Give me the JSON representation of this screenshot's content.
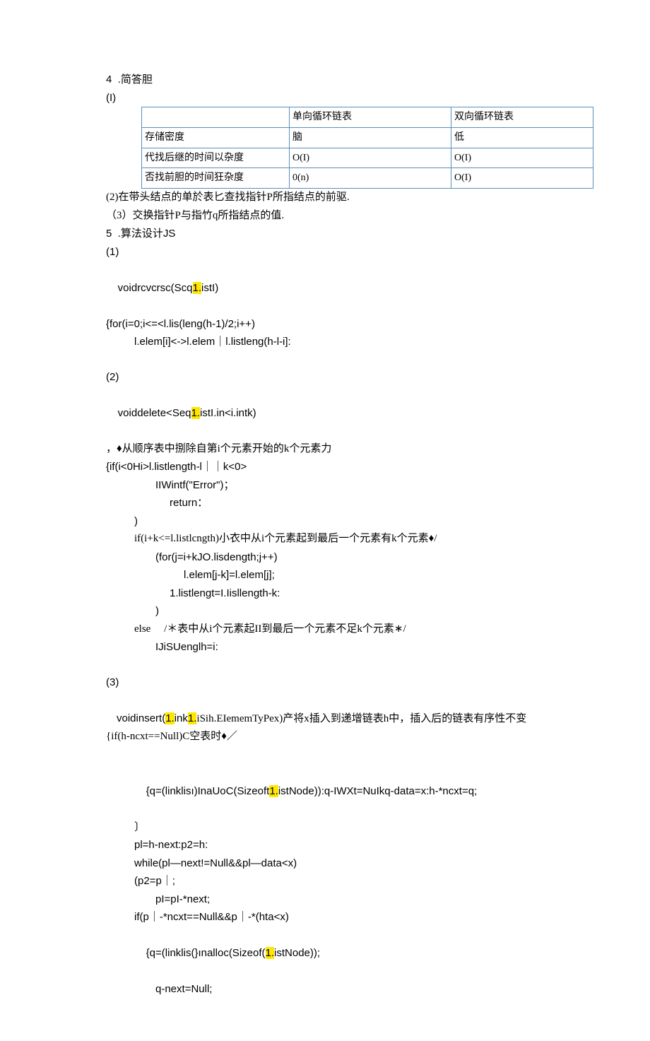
{
  "h4": "4  .简答胆",
  "l_I": "(I)",
  "table": {
    "r0": {
      "c0": "",
      "c1": "单向循环链表",
      "c2": "双向循环链表"
    },
    "r1": {
      "c0": "存储密度",
      "c1": "脑",
      "c2": "低"
    },
    "r2": {
      "c0": "代找后继的时间以杂度",
      "c1": "O(I)",
      "c2": "O(I)"
    },
    "r3": {
      "c0": "否找前胆的时间狂杂度",
      "c1": "0(n)",
      "c2": "O(I)"
    }
  },
  "p2": "(2)在带头结点的单於表匕查找指针P所指结点的前驱.",
  "p3": "（3）交换指针P与指竹q所指结点的值.",
  "h5": "5  .算法设计JS",
  "s1": {
    "a": "(1)",
    "b1": "voidrcvcrsc(Scq",
    "b_hl": "1.",
    "b2": "istI)",
    "c": "{for(i=0;i<=<l.lis(leng(h-1)/2;i++)",
    "d": "l.elem[i]<->l.elem｜l.listleng(h-l-i]:"
  },
  "s2": {
    "a": "(2)",
    "b1": "voiddelete<Seq",
    "b_hl": "1.",
    "b2": "istI.in<i.intk)",
    "c": "，♦从顺序表中捌除自第i个元素开始的k个元素力",
    "d": "{if(i<0Hi>l.listlength-l｜｜k<0>",
    "e": "IIWintf(\"Error\")；",
    "f": "return：",
    "g": ")",
    "h": "if(i+k<=l.listlcngth)小衣中从i个元素起到最后一个元素有k个元素♦/",
    "i": "(for(j=i+kJO.lisdength;j++)",
    "j": "l.elem[j-k]=l.elem[j];",
    "k": "1.listlengt=I.Iisllength-k:",
    "l": ")",
    "m": "else     /＊表中从i个元素起II到最后一个元素不足k个元素∗/",
    "n": "IJiSUenglh=i:"
  },
  "s3": {
    "a": "(3)",
    "b1": "voidinsert(",
    "b_hl1": "1.",
    "b2": "ink",
    "b_hl2": "1.",
    "b3": "iSih.EIememTyPex)产将x插入到递增链表h中，插入后的链表有序性不变{if(h-ncxt==Null)C空表时♦／",
    "c1": "{q=(linklisı)InaUoC(Sizeoft",
    "c_hl": "1.",
    "c2": "istNode)):q-IWXt=NuIkq-data=x:h-*ncxt=q;",
    "d": "〕",
    "e": "pl=h-next:p2=h:",
    "f": "while(pl—next!=Null&&pl—data<x)",
    "g": "(p2=p｜;",
    "h": "pI=pI-*next;",
    "i": "if(p｜-*ncxt==Null&&p｜-*(hta<x)",
    "j1": "{q=(linklis(}ınalloc(Sizeof(",
    "j_hl": "1.",
    "j2": "istNode));",
    "k": "q-next=Null;"
  }
}
